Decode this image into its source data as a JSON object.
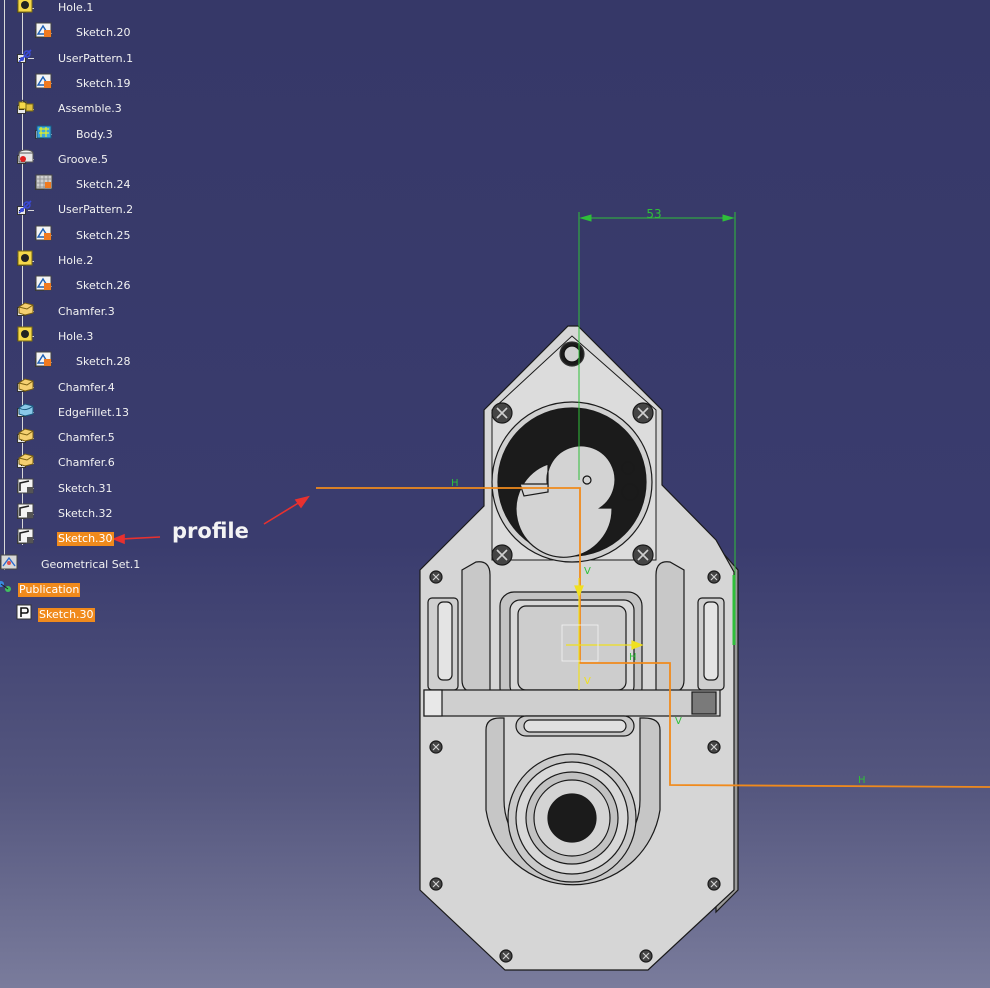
{
  "tree": {
    "items": [
      {
        "label": "Hole.1",
        "indent": 1,
        "expander": "minus",
        "icon": "hole-icon"
      },
      {
        "label": "Sketch.20",
        "indent": 2,
        "expander": "plus",
        "icon": "sketch-icon"
      },
      {
        "label": "UserPattern.1",
        "indent": 1,
        "expander": "minus",
        "icon": "user-pattern-icon"
      },
      {
        "label": "Sketch.19",
        "indent": 2,
        "expander": "plus",
        "icon": "sketch-icon"
      },
      {
        "label": "Assemble.3",
        "indent": 1,
        "expander": "minus",
        "icon": "assemble-icon"
      },
      {
        "label": "Body.3",
        "indent": 2,
        "expander": "plus",
        "icon": "body-icon"
      },
      {
        "label": "Groove.5",
        "indent": 1,
        "expander": "minus",
        "icon": "groove-icon"
      },
      {
        "label": "Sketch.24",
        "indent": 2,
        "expander": "plus",
        "icon": "sketch-grid-icon"
      },
      {
        "label": "UserPattern.2",
        "indent": 1,
        "expander": "minus",
        "icon": "user-pattern-icon"
      },
      {
        "label": "Sketch.25",
        "indent": 2,
        "expander": "plus",
        "icon": "sketch-icon"
      },
      {
        "label": "Hole.2",
        "indent": 1,
        "expander": "minus",
        "icon": "hole-icon"
      },
      {
        "label": "Sketch.26",
        "indent": 2,
        "expander": "plus",
        "icon": "sketch-icon"
      },
      {
        "label": "Chamfer.3",
        "indent": 1,
        "expander": "plus",
        "icon": "chamfer-icon"
      },
      {
        "label": "Hole.3",
        "indent": 1,
        "expander": "minus",
        "icon": "hole-icon"
      },
      {
        "label": "Sketch.28",
        "indent": 2,
        "expander": "plus",
        "icon": "sketch-icon"
      },
      {
        "label": "Chamfer.4",
        "indent": 1,
        "expander": "plus",
        "icon": "chamfer-icon"
      },
      {
        "label": "EdgeFillet.13",
        "indent": 1,
        "expander": "plus",
        "icon": "edge-fillet-icon"
      },
      {
        "label": "Chamfer.5",
        "indent": 1,
        "expander": "plus",
        "icon": "chamfer-icon"
      },
      {
        "label": "Chamfer.6",
        "indent": 1,
        "expander": "plus",
        "icon": "chamfer-icon"
      },
      {
        "label": "Sketch.31",
        "indent": 1,
        "expander": "plus",
        "icon": "sketch-outline-icon"
      },
      {
        "label": "Sketch.32",
        "indent": 1,
        "expander": "plus",
        "icon": "sketch-outline-icon"
      },
      {
        "label": "Sketch.30",
        "indent": 1,
        "expander": "plus",
        "icon": "sketch-outline-icon",
        "selected": true
      },
      {
        "label": "Geometrical Set.1",
        "indent": 0,
        "expander": "plus",
        "icon": "geometrical-set-icon"
      },
      {
        "label": "Publication",
        "indent": -1,
        "expander": "none",
        "icon": "publication-icon",
        "selected": true
      },
      {
        "label": "Sketch.30",
        "indent": 0.5,
        "expander": "none",
        "icon": "publication-item-icon",
        "selected": true
      }
    ]
  },
  "annotation": {
    "label": "profile",
    "arrow_color": "#e8312f"
  },
  "viewport": {
    "dimension_value": "53",
    "constraint_h_label": "H",
    "constraint_v_label": "V",
    "colors": {
      "profile": "#f08a1c",
      "dimension": "#2fbf3a",
      "axis": "#f0e020",
      "part_fill": "#d4d4d4",
      "part_stroke": "#1a1a1a"
    }
  }
}
